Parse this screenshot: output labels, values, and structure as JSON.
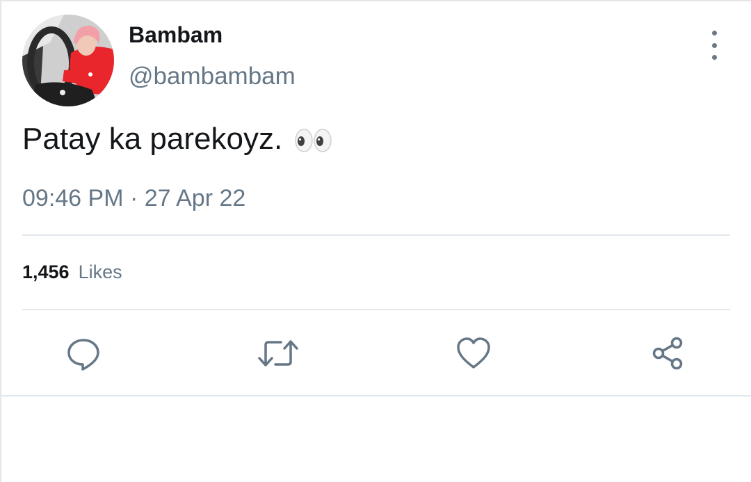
{
  "tweet": {
    "author": {
      "display_name": "Bambam",
      "handle": "@bambambam"
    },
    "text": "Patay ka parekoyz.",
    "emoji": "eyes-emoji",
    "timestamp": "09:46 PM · 27 Apr 22",
    "likes": {
      "count": "1,456",
      "label": "Likes"
    }
  },
  "actions": [
    {
      "name": "reply",
      "icon": "speech-bubble-icon"
    },
    {
      "name": "retweet",
      "icon": "retweet-arrows-icon"
    },
    {
      "name": "like",
      "icon": "heart-icon"
    },
    {
      "name": "share",
      "icon": "share-nodes-icon"
    }
  ],
  "menu": {
    "icon": "vertical-dots-icon"
  },
  "colors": {
    "text_primary": "#14171a",
    "text_secondary": "#657786",
    "icon": "#657786",
    "divider": "#e1e8ed",
    "avatar_shirt": "#e8262b",
    "avatar_hair": "#f2a0a8"
  }
}
